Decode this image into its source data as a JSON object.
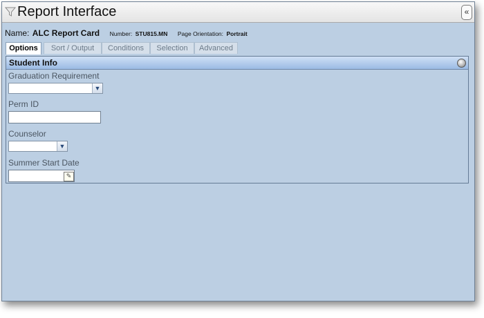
{
  "window": {
    "title": "Report Interface",
    "title_icon": "funnel-icon",
    "collapse_symbol": "«"
  },
  "report": {
    "name_label": "Name:",
    "name_value": "ALC Report Card",
    "number_label": "Number:",
    "number_value": "STU815.MN",
    "orientation_label": "Page Orientation:",
    "orientation_value": "Portrait"
  },
  "tabs": [
    {
      "label": "Options",
      "active": true
    },
    {
      "label": "Sort / Output",
      "active": false
    },
    {
      "label": "Conditions",
      "active": false
    },
    {
      "label": "Selection",
      "active": false
    },
    {
      "label": "Advanced",
      "active": false
    }
  ],
  "section": {
    "title": "Student Info",
    "fields": {
      "graduation_requirement": {
        "label": "Graduation Requirement",
        "value": ""
      },
      "perm_id": {
        "label": "Perm ID",
        "value": ""
      },
      "counselor": {
        "label": "Counselor",
        "value": ""
      },
      "summer_start_date": {
        "label": "Summer Start Date",
        "value": ""
      }
    }
  },
  "colors": {
    "panel_bg": "#bccfe3",
    "section_header": "#9bbbe4",
    "border": "#647a95"
  }
}
